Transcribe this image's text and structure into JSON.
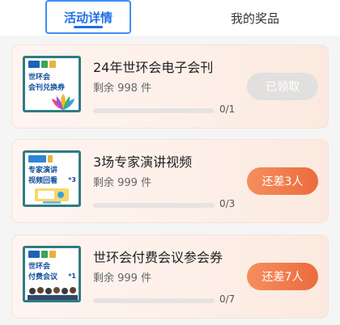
{
  "tabs": {
    "active_label": "活动详情",
    "inactive_label": "我的奖品"
  },
  "colors": {
    "accent": "#1f6fe5",
    "primary_button": "#ec6b3d",
    "disabled_button": "#e2e0df"
  },
  "rewards": [
    {
      "name": "24年世环会电子会刊",
      "remaining": "剩余 998 件",
      "progress_text": "0/1",
      "progress_value": 0,
      "action_label": "已领取",
      "action_state": "disabled",
      "thumb": {
        "line1": "世环会",
        "line2": "会刊兑换券",
        "badge": ""
      }
    },
    {
      "name": "3场专家演讲视频",
      "remaining": "剩余 999 件",
      "progress_text": "0/3",
      "progress_value": 0,
      "action_label": "还差3人",
      "action_state": "active",
      "thumb": {
        "line1": "专家演讲",
        "line2": "视频回看",
        "badge": "*3"
      }
    },
    {
      "name": "世环会付费会议参会券",
      "remaining": "剩余 999 件",
      "progress_text": "0/7",
      "progress_value": 0,
      "action_label": "还差7人",
      "action_state": "active",
      "thumb": {
        "line1": "世环会",
        "line2": "付费会议",
        "badge": "*1"
      }
    }
  ]
}
